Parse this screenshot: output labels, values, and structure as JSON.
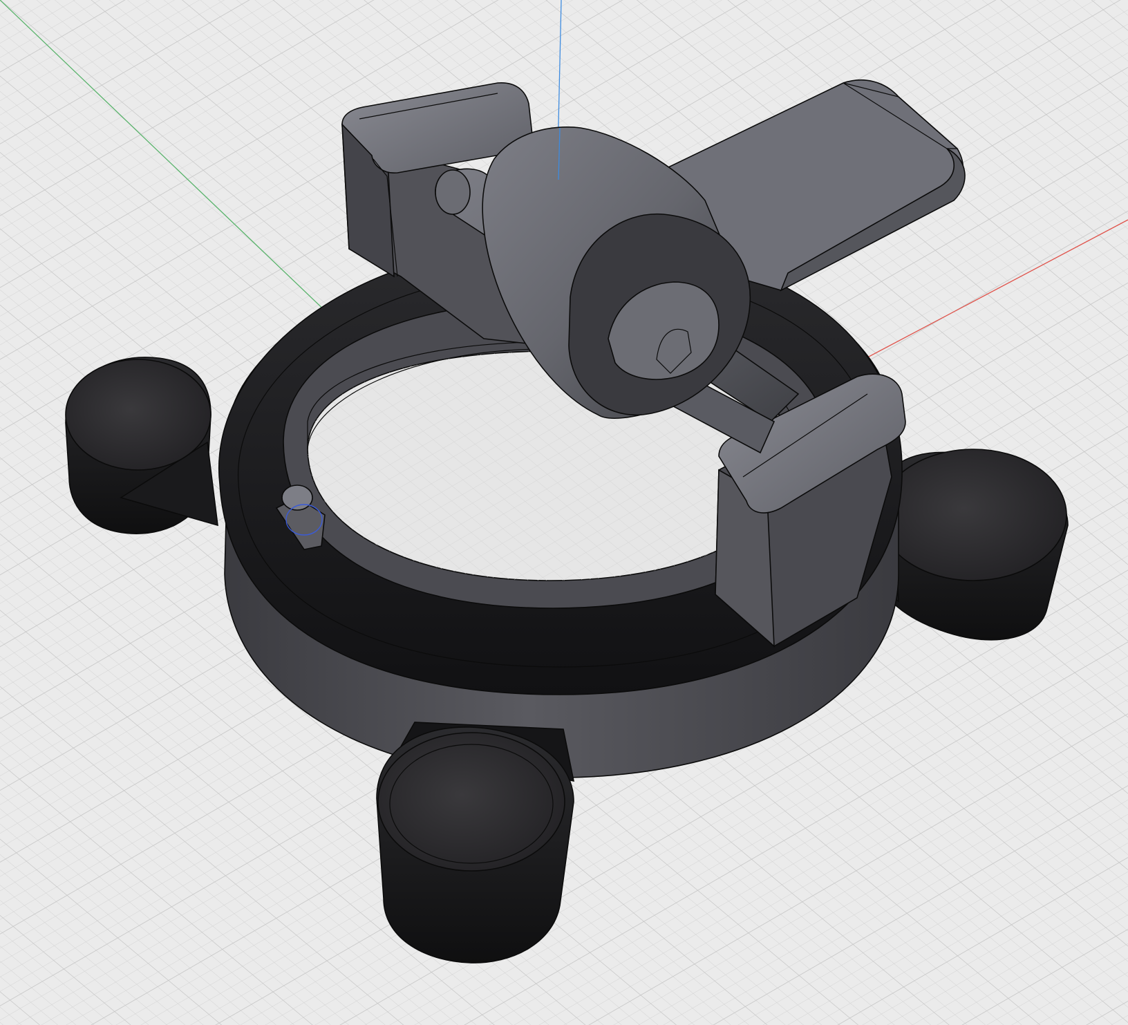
{
  "viewport": {
    "background": "#e9e9e9",
    "grid_minor_color": "#d4d4d4",
    "grid_major_color": "#c9c9c9",
    "axes": {
      "x": {
        "color": "#e0524a"
      },
      "y": {
        "color": "#59b36b"
      },
      "z": {
        "color": "#3d8be0"
      }
    },
    "selection_color": "#3b5bd6"
  },
  "model": {
    "body_color": "#4f4f55",
    "dark_color": "#1c1c1f",
    "light_color": "#6f7078"
  }
}
